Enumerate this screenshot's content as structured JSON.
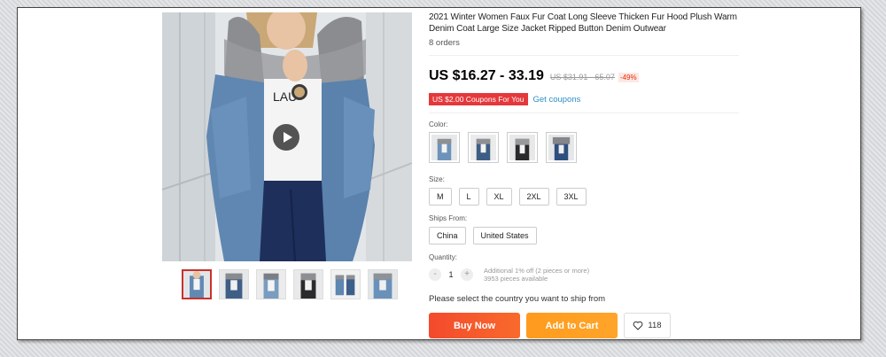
{
  "product": {
    "title": "2021 Winter Women Faux Fur Coat Long Sleeve Thicken Fur Hood Plush Warm Denim Coat Large Size Jacket Ripped Button Denim Outwear",
    "orders": "8 orders",
    "price": "US $16.27 - 33.19",
    "original_price": "US $31.91 - 65.07",
    "discount": "-49%"
  },
  "coupon": {
    "badge": "US $2.00 Coupons For You",
    "link": "Get coupons"
  },
  "color": {
    "label": "Color:",
    "swatches": [
      "light-denim-gray-fur",
      "dark-denim-gray-fur",
      "black-gray-fur",
      "navy-gray-fur"
    ]
  },
  "size": {
    "label": "Size:",
    "options": [
      "M",
      "L",
      "XL",
      "2XL",
      "3XL"
    ]
  },
  "ships_from": {
    "label": "Ships From:",
    "options": [
      "China",
      "United States"
    ]
  },
  "quantity": {
    "label": "Quantity:",
    "minus": "-",
    "value": "1",
    "plus": "+",
    "discount_note": "Additional 1% off (2 pieces or more)",
    "available": "3953 pieces available"
  },
  "ship_message": "Please select the country you want to ship from",
  "actions": {
    "buy_now": "Buy Now",
    "add_to_cart": "Add to Cart",
    "wishlist_count": "118"
  },
  "colors": {
    "buy_now": "#f34a2d",
    "add_to_cart": "#ff9b1e",
    "price_discount": "#e62e04",
    "coupon": "#e5383b",
    "link": "#2d8fc8"
  },
  "gallery": {
    "thumbnail_count": 6,
    "active_thumbnail": 0,
    "play_icon": "play-icon"
  }
}
